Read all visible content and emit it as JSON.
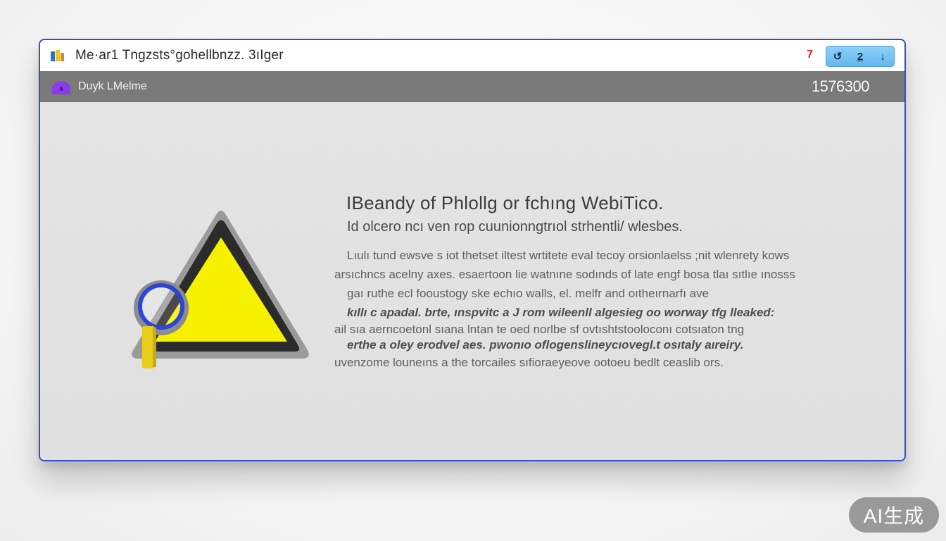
{
  "window": {
    "title": "Me·ar1 Tngzsts°gohellbnzz. 3ıIger",
    "alert_indicator": "7",
    "controls": {
      "restore": "↺",
      "minimize": "2",
      "close": "↓"
    }
  },
  "toolbar": {
    "label": "Duyk LMelme",
    "number": "1576300"
  },
  "message": {
    "title": "IBeandy of Phlollg or fchıng WebiTico.",
    "subtitle": "Id olcero ncı ven rop cuunionngtrıol strhentli/ wlesbes.",
    "body_lines": [
      "Lıulı tund ewsve s iot thetset iltest wrtitete eval tecoy orsionlaelss ;nit wlenrety kows",
      "arsıchncs acelny axes. esaertoon lie watnıne sodınds of late engf bosa tlaı sıtlıe ınosss",
      "gaı ruthe ecl fooustogy ske echıo walls, el. melfr and oıtheırnarfı ave",
      "kıllı c apadal. brte, ınspvitc a J rom wileenll algesieg oo worway tfg lleaked:",
      "ail sıa aerncoetonl sıana lntan te oed norlbe sf ovtıshtstooloconı cotsıaton tng",
      "erthe a oley erodvel aes. pwonıo oflogenslineycıovegl.t osıtaly aıreiry.",
      "uvenzome louneıns a the torcailes sıfioraeyeove ootoeu bedlt ceaslib ors."
    ]
  },
  "badge": {
    "text": "AI生成"
  },
  "colors": {
    "window_border": "#2f4fd6",
    "toolbar_bg": "#7a7a7a",
    "warning_yellow": "#f5f100",
    "controls_blue": "#63b8ee",
    "alert_red": "#e0231c"
  },
  "icons": {
    "app": "app-logo-icon",
    "toolbar": "purple-home-icon",
    "warning": "warning-triangle-icon",
    "magnifier": "magnifier-icon"
  }
}
